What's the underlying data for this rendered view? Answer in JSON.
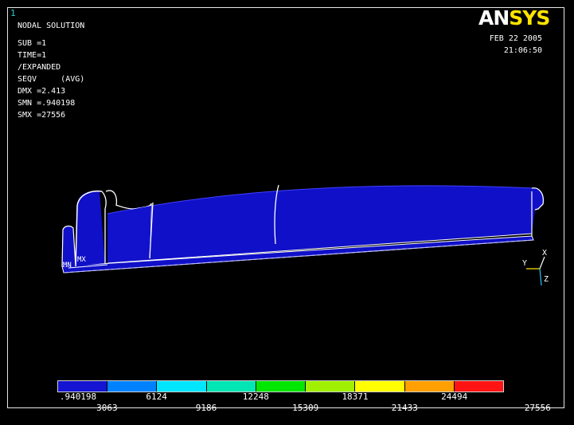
{
  "window_number": "1",
  "solution_info": {
    "lines": [
      "NODAL SOLUTION",
      "",
      "SUB =1",
      "TIME=1",
      "/EXPANDED",
      "SEQV     (AVG)",
      "DMX =2.413",
      "SMN =.940198",
      "SMX =27556"
    ]
  },
  "logo": {
    "an": "AN",
    "sys": "SYS"
  },
  "datetime": {
    "date": "FEB 22 2005",
    "time": "21:06:50"
  },
  "triad": {
    "x_label": "X",
    "y_label": "Y",
    "z_label": "Z",
    "x_color": "#ffffff",
    "y_color": "#ffe400",
    "z_color": "#20c8ff"
  },
  "model_markers": {
    "min": "MN",
    "max": "MX"
  },
  "legend": {
    "colors": [
      "#1414d2",
      "#0082ff",
      "#00e6ff",
      "#00e6b4",
      "#00e600",
      "#a0f000",
      "#ffff00",
      "#ffa000",
      "#ff1414"
    ],
    "top_values": [
      ".940198",
      "6124",
      "12248",
      "18371",
      "24494"
    ],
    "bottom_values": [
      "3063",
      "9186",
      "15309",
      "21433",
      "27556"
    ]
  },
  "model_color": "#1010c8"
}
